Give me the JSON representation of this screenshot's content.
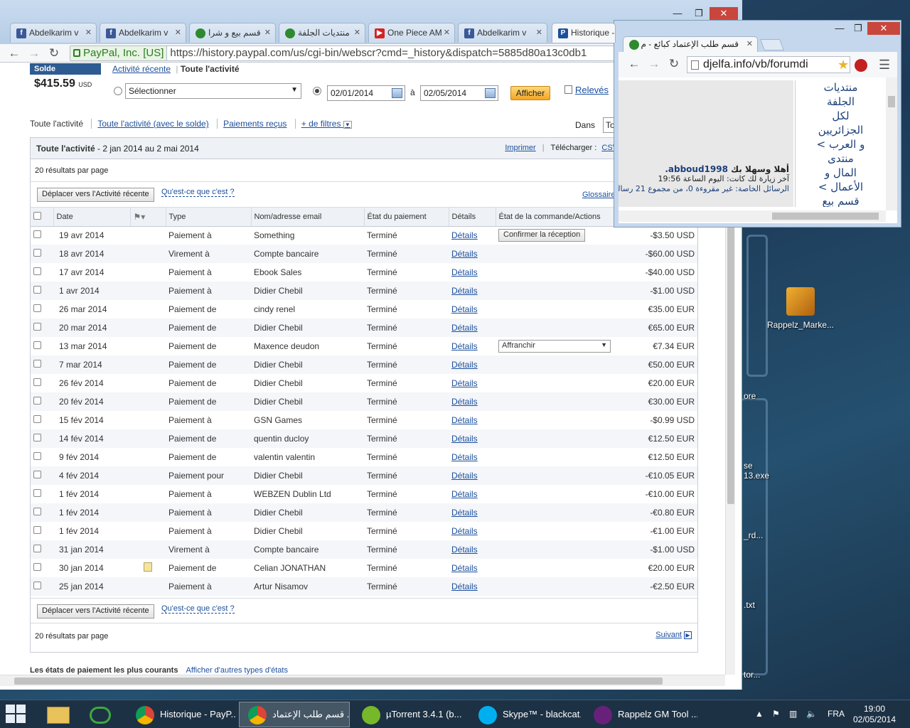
{
  "desktop": {
    "icon_label": "Rappelz_Marke...",
    "fragments": [
      "ore",
      "se",
      "13.exe",
      "_rd...",
      ".txt",
      "tor..."
    ]
  },
  "browser": {
    "tabs": [
      {
        "label": "Abdelkarim v",
        "icon": "facebook-icon"
      },
      {
        "label": "Abdelkarim v",
        "icon": "facebook-icon"
      },
      {
        "label": "قسم بيع و شرا",
        "icon": "djelfa-icon"
      },
      {
        "label": "منتديات الجلفة",
        "icon": "djelfa-icon"
      },
      {
        "label": "One Piece AM",
        "icon": "youtube-icon"
      },
      {
        "label": "Abdelkarim v",
        "icon": "facebook-icon"
      },
      {
        "label": "Historique -",
        "icon": "paypal-icon"
      }
    ],
    "secure_label": "PayPal, Inc. [US]",
    "url": "https://history.paypal.com/us/cgi-bin/webscr?cmd=_history&dispatch=5885d80a13c0db1"
  },
  "paypal": {
    "solde_label": "Solde",
    "solde_amount": "$415.59",
    "solde_currency": "USD",
    "link_recent": "Activité récente",
    "link_all": "Toute l'activité",
    "select_value": "Sélectionner",
    "date_from": "02/01/2014",
    "date_sep": "à",
    "date_to": "02/05/2014",
    "btn_afficher": "Afficher",
    "releves": "Relevés",
    "filter_tabs": [
      "Toute l'activité",
      "Toute l'activité (avec le solde)",
      "Paiements reçus",
      "+ de filtres"
    ],
    "dans_label": "Dans",
    "dans_value": "To",
    "panel_title": "Toute l'activité",
    "panel_range": " - 2 jan 2014 au 2 mai 2014",
    "imprimer": "Imprimer",
    "telecharger": "Télécharger :",
    "csv": "CSV",
    "results_per_page": "20 résultats par page",
    "btn_move": "Déplacer vers l'Activité récente",
    "help_link": "Qu'est-ce que c'est ?",
    "glossaire": "Glossaire",
    "columns": [
      "Date",
      "Type",
      "Nom/adresse email",
      "État du paiement",
      "Détails",
      "État de la commande/Actions"
    ],
    "rows": [
      {
        "date": "19 avr 2014",
        "type": "Paiement à",
        "name": "Something",
        "status": "Terminé",
        "details": "Détails",
        "action": "Confirmer la réception",
        "amount": "-$3.50 USD"
      },
      {
        "date": "18 avr 2014",
        "type": "Virement à",
        "name": "Compte bancaire",
        "status": "Terminé",
        "details": "Détails",
        "action": "",
        "amount": "-$60.00 USD"
      },
      {
        "date": "17 avr 2014",
        "type": "Paiement à",
        "name": "Ebook Sales",
        "status": "Terminé",
        "details": "Détails",
        "action": "",
        "amount": "-$40.00 USD"
      },
      {
        "date": "1 avr 2014",
        "type": "Paiement à",
        "name": "Didier Chebil",
        "status": "Terminé",
        "details": "Détails",
        "action": "",
        "amount": "-$1.00 USD"
      },
      {
        "date": "26 mar 2014",
        "type": "Paiement de",
        "name": "cindy renel",
        "status": "Terminé",
        "details": "Détails",
        "action": "",
        "amount": "€35.00 EUR"
      },
      {
        "date": "20 mar 2014",
        "type": "Paiement de",
        "name": "Didier Chebil",
        "status": "Terminé",
        "details": "Détails",
        "action": "",
        "amount": "€65.00 EUR"
      },
      {
        "date": "13 mar 2014",
        "type": "Paiement de",
        "name": "Maxence deudon",
        "status": "Terminé",
        "details": "Détails",
        "action_select": "Affranchir",
        "amount": "€7.34 EUR"
      },
      {
        "date": "7 mar 2014",
        "type": "Paiement de",
        "name": "Didier Chebil",
        "status": "Terminé",
        "details": "Détails",
        "action": "",
        "amount": "€50.00 EUR"
      },
      {
        "date": "26 fév 2014",
        "type": "Paiement de",
        "name": "Didier Chebil",
        "status": "Terminé",
        "details": "Détails",
        "action": "",
        "amount": "€20.00 EUR"
      },
      {
        "date": "20 fév 2014",
        "type": "Paiement de",
        "name": "Didier Chebil",
        "status": "Terminé",
        "details": "Détails",
        "action": "",
        "amount": "€30.00 EUR"
      },
      {
        "date": "15 fév 2014",
        "type": "Paiement à",
        "name": "GSN Games",
        "status": "Terminé",
        "details": "Détails",
        "action": "",
        "amount": "-$0.99 USD"
      },
      {
        "date": "14 fév 2014",
        "type": "Paiement de",
        "name": "quentin ducloy",
        "status": "Terminé",
        "details": "Détails",
        "action": "",
        "amount": "€12.50 EUR"
      },
      {
        "date": "9 fév 2014",
        "type": "Paiement de",
        "name": "valentin valentin",
        "status": "Terminé",
        "details": "Détails",
        "action": "",
        "amount": "€12.50 EUR"
      },
      {
        "date": "4 fév 2014",
        "type": "Paiement pour",
        "name": "Didier Chebil",
        "status": "Terminé",
        "details": "Détails",
        "action": "",
        "amount": "-€10.05 EUR"
      },
      {
        "date": "1 fév 2014",
        "type": "Paiement à",
        "name": "WEBZEN Dublin Ltd",
        "status": "Terminé",
        "details": "Détails",
        "action": "",
        "amount": "-€10.00 EUR"
      },
      {
        "date": "1 fév 2014",
        "type": "Paiement à",
        "name": "Didier Chebil",
        "status": "Terminé",
        "details": "Détails",
        "action": "",
        "amount": "-€0.80 EUR"
      },
      {
        "date": "1 fév 2014",
        "type": "Paiement à",
        "name": "Didier Chebil",
        "status": "Terminé",
        "details": "Détails",
        "action": "",
        "amount": "-€1.00 EUR"
      },
      {
        "date": "31 jan 2014",
        "type": "Virement à",
        "name": "Compte bancaire",
        "status": "Terminé",
        "details": "Détails",
        "action": "",
        "amount": "-$1.00 USD"
      },
      {
        "date": "30 jan 2014",
        "type": "Paiement de",
        "name": "Celian JONATHAN",
        "status": "Terminé",
        "details": "Détails",
        "action": "",
        "note": true,
        "amount": "€20.00 EUR"
      },
      {
        "date": "25 jan 2014",
        "type": "Paiement à",
        "name": "Artur Nisamov",
        "status": "Terminé",
        "details": "Détails",
        "action": "",
        "amount": "-€2.50 EUR"
      }
    ],
    "suivant": "Suivant",
    "bottom_title": "Les états de paiement les plus courants",
    "bottom_link": "Afficher d'autres types d'états"
  },
  "popup": {
    "tab_label": "قسم طلب الإعتماد كبائع - م",
    "url": "djelfa.info/vb/forumdi",
    "nav_lines": [
      "منتديات",
      "الجلفة",
      "لكل",
      "الجزائريين",
      "و العرب >",
      "منتدى",
      "المال و",
      "الأعمال >",
      "قسم بيع"
    ],
    "welcome": "أهلا وسهلا بك",
    "username": "abboud1998.",
    "last_visit": "آخر زيارة لك كانت: اليوم الساعة 19:56",
    "pm_label": "الرسائل الخاصة:",
    "pm_text": "غير مقروءة 0، من مجموع 21 رسالة"
  },
  "taskbar": {
    "items": [
      {
        "label": "Historique - PayP...",
        "icon": "chrome-icon",
        "active": false
      },
      {
        "label": "قسم طلب الإعتماد ...",
        "icon": "chrome-icon",
        "active": true
      },
      {
        "label": "µTorrent 3.4.1  (b...",
        "icon": "utorrent-icon",
        "active": false
      },
      {
        "label": "Skype™ - blackcat...",
        "icon": "skype-icon",
        "active": false
      },
      {
        "label": "Rappelz GM Tool ...",
        "icon": "visual-studio-icon",
        "active": false
      }
    ],
    "lang": "FRA",
    "time": "19:00",
    "date": "02/05/2014"
  },
  "colors": {
    "paypal_blue": "#1b4f9c",
    "afficher_orange": "#f5a623",
    "desktop": "#1c3a57"
  }
}
